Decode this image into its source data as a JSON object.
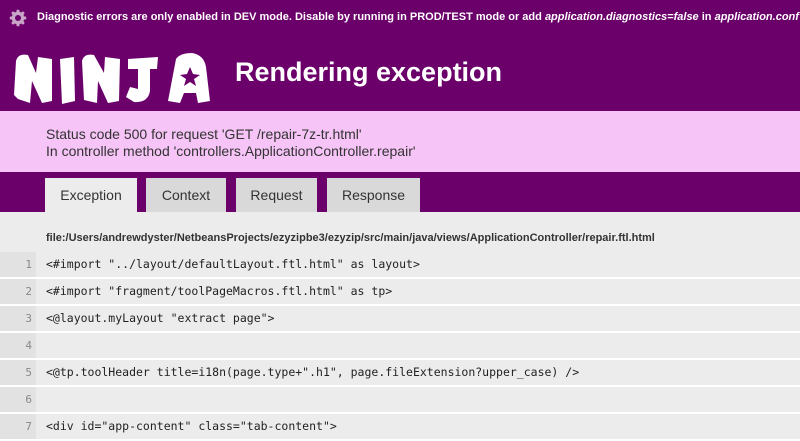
{
  "diagnostic_bar": {
    "message_prefix": "Diagnostic errors are only enabled in DEV mode. Disable by running in PROD/TEST mode or add ",
    "message_setting": "application.diagnostics=false",
    "message_in": " in ",
    "message_file": "application.conf",
    "icon": "gear-icon"
  },
  "header": {
    "logo_text": "NINJA",
    "title": "Rendering exception",
    "background_color": "#6b006b"
  },
  "status": {
    "line1": "Status code 500 for request 'GET /repair-7z-tr.html'",
    "line2": "In controller method 'controllers.ApplicationController.repair'",
    "background_color": "#f6c4f6"
  },
  "tabs": [
    {
      "label": "Exception",
      "active": true
    },
    {
      "label": "Context",
      "active": false
    },
    {
      "label": "Request",
      "active": false
    },
    {
      "label": "Response",
      "active": false
    }
  ],
  "file_path": "file:/Users/andrewdyster/NetbeansProjects/ezyzipbe3/ezyzip/src/main/java/views/ApplicationController/repair.ftl.html",
  "code_lines": [
    {
      "number": "1",
      "text": "<#import \"../layout/defaultLayout.ftl.html\" as layout>"
    },
    {
      "number": "2",
      "text": "<#import \"fragment/toolPageMacros.ftl.html\" as tp>"
    },
    {
      "number": "3",
      "text": "<@layout.myLayout \"extract page\">"
    },
    {
      "number": "4",
      "text": ""
    },
    {
      "number": "5",
      "text": "<@tp.toolHeader title=i18n(page.type+\".h1\", page.fileExtension?upper_case) />"
    },
    {
      "number": "6",
      "text": ""
    },
    {
      "number": "7",
      "text": "<div id=\"app-content\" class=\"tab-content\">"
    }
  ]
}
